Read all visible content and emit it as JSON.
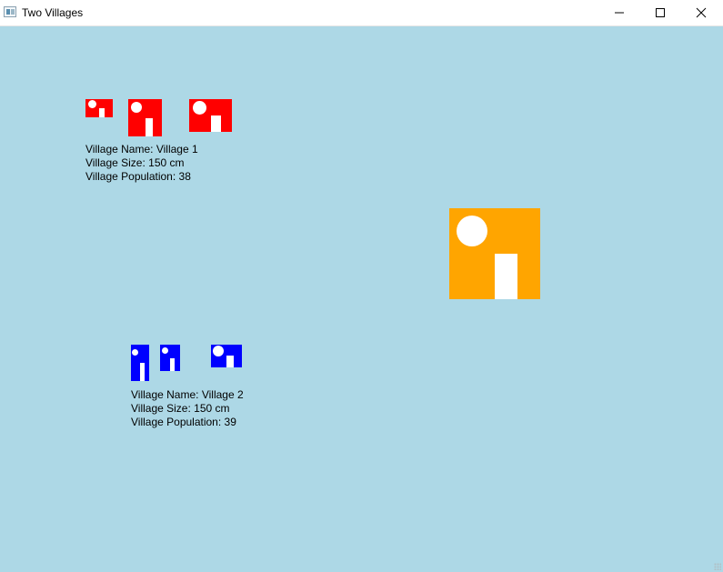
{
  "window": {
    "title": "Two Villages",
    "icon": "app-window-icon",
    "controls": {
      "minimize_glyph": "—",
      "maximize_glyph": "☐",
      "close_glyph": "✕"
    }
  },
  "colors": {
    "background": "#add8e6",
    "village1_houses": "#ff0000",
    "village2_houses": "#0000ff",
    "big_house": "#ffa500",
    "house_detail": "#ffffff"
  },
  "village1": {
    "name_line": "Village Name: Village 1",
    "size_line": "Village Size: 150 cm",
    "population_line": "Village Population: 38"
  },
  "village2": {
    "name_line": "Village Name: Village 2",
    "size_line": "Village Size: 150 cm",
    "population_line": "Village Population: 39"
  }
}
